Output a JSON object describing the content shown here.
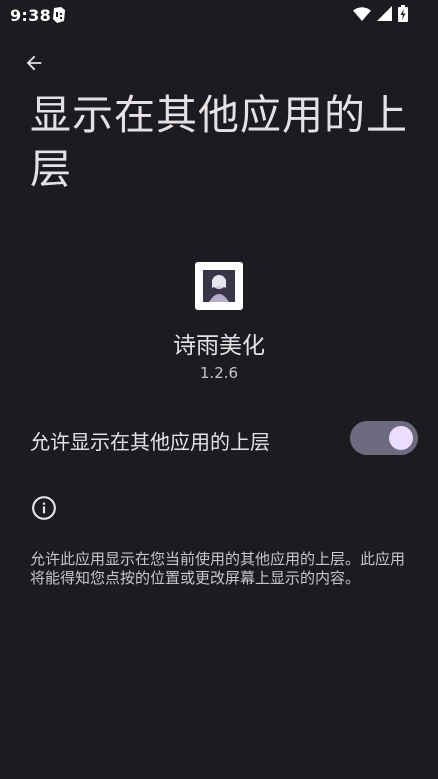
{
  "status_bar": {
    "time": "9:38",
    "app_icon": "gamepad-notification-icon",
    "wifi_icon": "wifi-icon",
    "signal_icon": "cellular-signal-icon",
    "battery_icon": "battery-charging-icon"
  },
  "header": {
    "back_icon": "arrow-back-icon",
    "title": "显示在其他应用的上层"
  },
  "app": {
    "name": "诗雨美化",
    "version": "1.2.6",
    "icon": "app-thumbnail"
  },
  "setting": {
    "label": "允许显示在其他应用的上层",
    "enabled": true
  },
  "info": {
    "icon": "info-icon",
    "description": "允许此应用显示在您当前使用的其他应用的上层。此应用将能得知您点按的位置或更改屏幕上显示的内容。"
  },
  "colors": {
    "background": "#1c1b1f",
    "toggle_track": "#6e6a80",
    "toggle_thumb": "#eaddff"
  }
}
